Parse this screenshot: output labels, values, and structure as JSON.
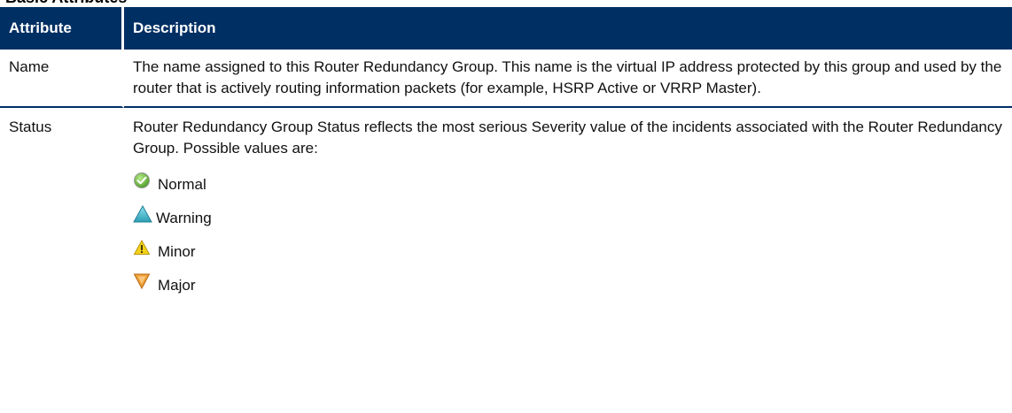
{
  "section_heading": "Basic Attributes",
  "table": {
    "headers": [
      "Attribute",
      "Description"
    ],
    "rows": [
      {
        "attribute": "Name",
        "description": "The name assigned to this Router Redundancy Group. This name is the virtual IP address protected by this group and used by the router that is actively routing information packets (for example, HSRP Active or VRRP Master)."
      },
      {
        "attribute": "Status",
        "description": "Router Redundancy Group Status reflects the most serious Severity value of the incidents associated with the Router Redundancy Group. Possible values are:",
        "status_values": [
          {
            "label": "Normal",
            "icon": "normal-status-icon",
            "color": "#6cbf3c"
          },
          {
            "label": "Warning",
            "icon": "warning-status-icon",
            "color": "#3fb3c9"
          },
          {
            "label": "Minor",
            "icon": "minor-status-icon",
            "color": "#f3d21b"
          },
          {
            "label": "Major",
            "icon": "major-status-icon",
            "color": "#f0a037"
          }
        ]
      }
    ]
  },
  "colors": {
    "header_bg": "#002f63",
    "header_text": "#ffffff",
    "row_divider": "#002f63"
  }
}
